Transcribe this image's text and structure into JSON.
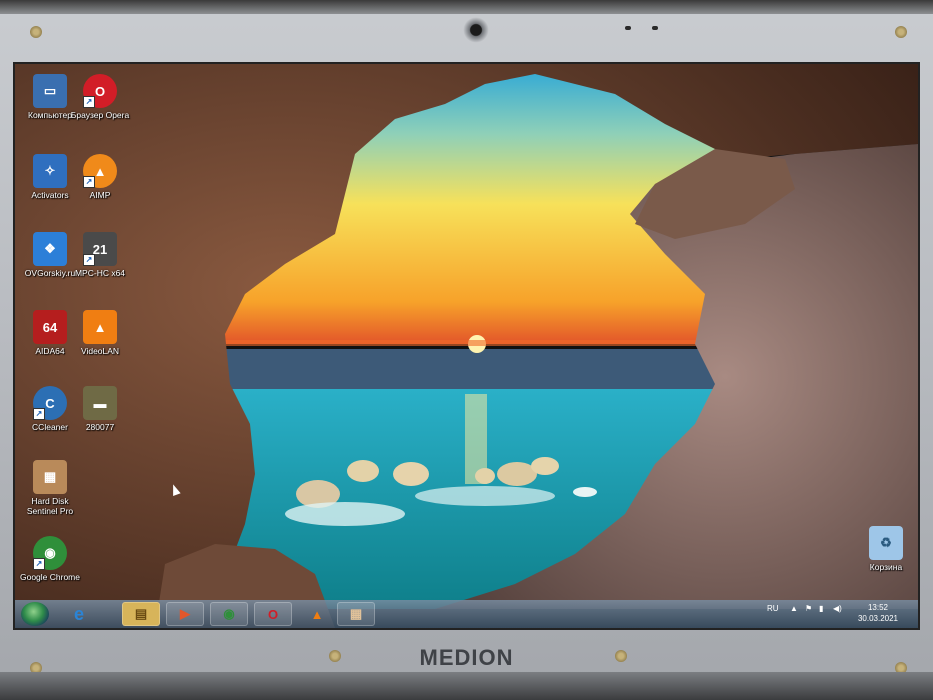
{
  "bezel": {
    "brand": "MEDION"
  },
  "desktop_icons": [
    {
      "id": "computer",
      "label": "Компьютер",
      "icon": "computer-icon",
      "color": "#3a6fb0",
      "glyph": "▭"
    },
    {
      "id": "opera-browser",
      "label": "Браузер Opera",
      "icon": "opera-icon",
      "color": "#d21d27",
      "glyph": "O"
    },
    {
      "id": "activators",
      "label": "Activators",
      "icon": "activators-icon",
      "color": "#2f6fbf",
      "glyph": "✧"
    },
    {
      "id": "aimp",
      "label": "AIMP",
      "icon": "aimp-icon",
      "color": "#f08a1a",
      "glyph": "▲"
    },
    {
      "id": "ovgorskiy",
      "label": "OVGorskiy.ru",
      "icon": "ovgorskiy-icon",
      "color": "#2c7fd8",
      "glyph": "❖"
    },
    {
      "id": "mpc-hc",
      "label": "MPC-HC x64",
      "icon": "mpc-hc-icon",
      "color": "#4a4a4a",
      "glyph": "21"
    },
    {
      "id": "aida64",
      "label": "AIDA64",
      "icon": "aida64-icon",
      "color": "#b51e1e",
      "glyph": "64"
    },
    {
      "id": "videolan",
      "label": "VideoLAN",
      "icon": "vlc-icon",
      "color": "#f07e12",
      "glyph": "▲"
    },
    {
      "id": "ccleaner",
      "label": "CCleaner",
      "icon": "ccleaner-icon",
      "color": "#2c6fb4",
      "glyph": "C"
    },
    {
      "id": "280077",
      "label": "280077",
      "icon": "tank-game-icon",
      "color": "#6f6a45",
      "glyph": "▬"
    },
    {
      "id": "hard-disk-sentinel",
      "label": "Hard Disk Sentinel Pro",
      "icon": "hard-disk-sentinel-icon",
      "color": "#b98a5a",
      "glyph": "▦"
    },
    {
      "id": "google-chrome",
      "label": "Google Chrome",
      "icon": "chrome-icon",
      "color": "#2f8f3a",
      "glyph": "◉"
    },
    {
      "id": "recycle-bin",
      "label": "Корзина",
      "icon": "recycle-bin-icon",
      "color": "#9ec6e8",
      "glyph": "♻"
    }
  ],
  "taskbar": {
    "buttons": [
      {
        "icon": "ie-icon",
        "glyph": "e",
        "color": "#2a84d6"
      },
      {
        "icon": "explorer-folder-icon",
        "glyph": "▤",
        "color": "#d7b45a"
      },
      {
        "icon": "media-player-icon",
        "glyph": "▶",
        "color": "#e2572b"
      },
      {
        "icon": "chrome-icon",
        "glyph": "◉",
        "color": "#2f8f3a"
      },
      {
        "icon": "opera-icon",
        "glyph": "O",
        "color": "#d21d27"
      },
      {
        "icon": "vlc-icon",
        "glyph": "▲",
        "color": "#f07e12"
      },
      {
        "icon": "hard-disk-sentinel-icon",
        "glyph": "▦",
        "color": "#b98a5a"
      }
    ],
    "language": "RU",
    "time": "13:52",
    "date": "30.03.2021"
  }
}
